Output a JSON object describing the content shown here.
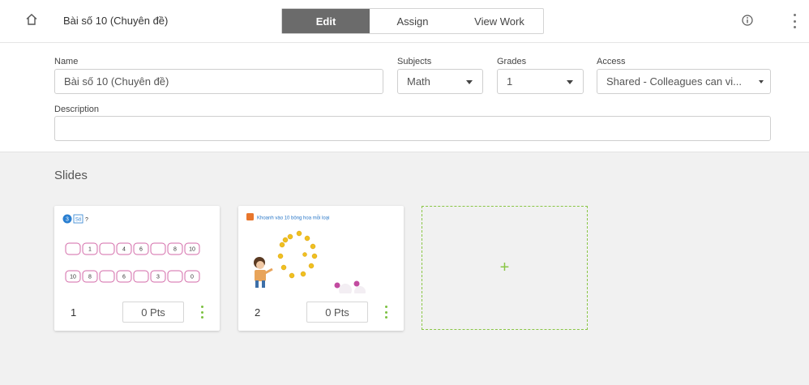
{
  "header": {
    "title": "Bài số 10 (Chuyên đề)",
    "tabs": [
      {
        "label": "Edit",
        "active": true
      },
      {
        "label": "Assign",
        "active": false
      },
      {
        "label": "View Work",
        "active": false
      }
    ],
    "icons": {
      "home": "home-icon",
      "info": "info-icon",
      "more": "kebab-menu-icon"
    }
  },
  "details": {
    "name_label": "Name",
    "name_value": "Bài số 10 (Chuyên đề)",
    "subjects_label": "Subjects",
    "subjects_value": "Math",
    "grades_label": "Grades",
    "grades_value": "1",
    "access_label": "Access",
    "access_value": "Shared - Colleagues can vi...",
    "description_label": "Description",
    "description_value": ""
  },
  "slides": {
    "heading": "Slides",
    "items": [
      {
        "number": "1",
        "points": "0 Pts",
        "thumb": {
          "badge": "3",
          "prompt": "Số",
          "mark": "?",
          "row1": [
            "",
            "1",
            "",
            "4",
            "6",
            "",
            "8",
            "10"
          ],
          "row2": [
            "10",
            "8",
            "",
            "6",
            "",
            "3",
            "",
            "0"
          ]
        }
      },
      {
        "number": "2",
        "points": "0 Pts",
        "thumb": {
          "instruction": "Khoanh vào 10 bông hoa mỗi loại"
        }
      }
    ],
    "add_label": "+"
  },
  "colors": {
    "accent_green": "#8ac646",
    "active_tab": "#6b6b6b",
    "slide_badge_blue": "#2a7fd1",
    "slide_pink": "#d36aa8",
    "instruction_blue": "#2a78c8",
    "flower_yellow": "#f0c020",
    "flower_pink": "#c24ba0"
  }
}
